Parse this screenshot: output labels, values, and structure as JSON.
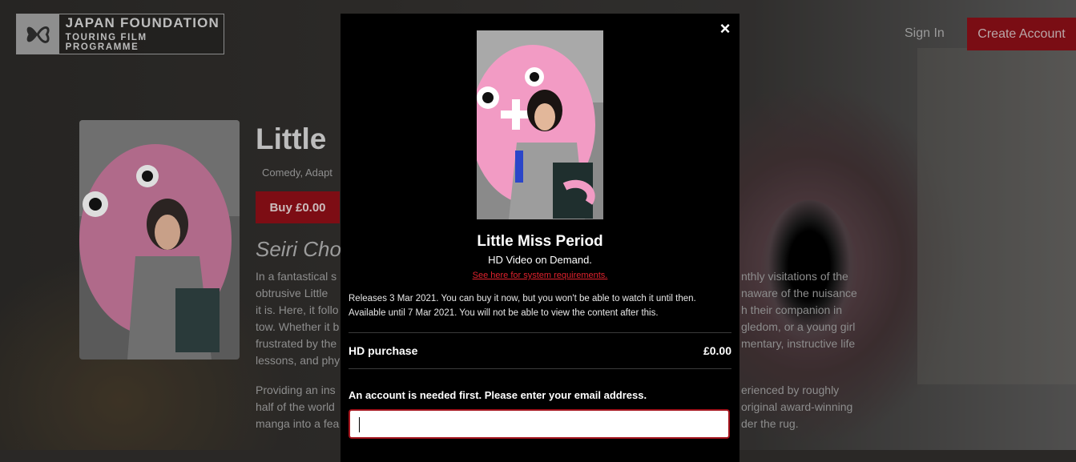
{
  "header": {
    "logo_line1": "JAPAN FOUNDATION",
    "logo_line2": "TOURING FILM PROGRAMME",
    "sign_in": "Sign In",
    "create_account": "Create Account"
  },
  "background_page": {
    "title": "Little",
    "genres": "Comedy, Adapt",
    "buy_button": "Buy £0.00",
    "subtitle": "Seiri Cho",
    "para1_left": [
      "In a fantastical s",
      "obtrusive Little",
      "it is. Here, it follo",
      "tow. Whether it b",
      "frustrated by the",
      "lessons, and phy"
    ],
    "para1_right": [
      "nthly visitations of the",
      "naware of the nuisance",
      "h their companion in",
      "gledom, or a young girl",
      "mentary, instructive life",
      ""
    ],
    "para2_left": [
      "Providing an ins",
      "half of the world",
      "manga into a fea"
    ],
    "para2_right": [
      "erienced by roughly",
      "original award-winning",
      "der the rug."
    ]
  },
  "modal": {
    "close_label": "×",
    "title": "Little Miss Period",
    "format": "HD Video on Demand.",
    "system_requirements_link": "See here for system requirements.",
    "release_line1": "Releases 3 Mar 2021. You can buy it now, but you won't be able to watch it until then.",
    "release_line2": "Available until 7 Mar 2021. You will not be able to view the content after this.",
    "purchase_label": "HD purchase",
    "purchase_price": "£0.00",
    "account_message": "An account is needed first. Please enter your email address.",
    "email_value": "",
    "accent_color": "#e0222d"
  }
}
